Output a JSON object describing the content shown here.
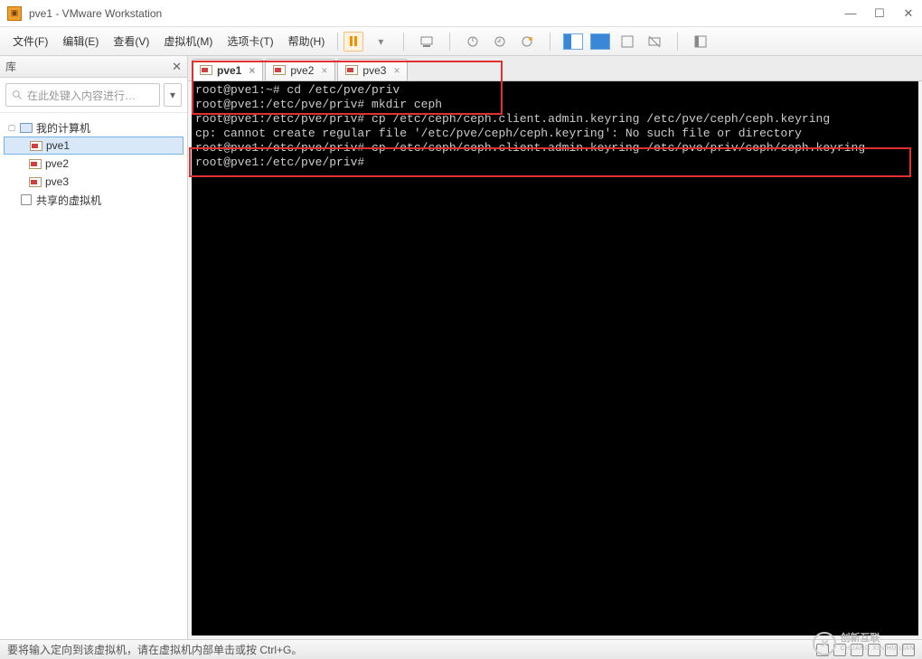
{
  "window": {
    "title": "pve1 - VMware Workstation"
  },
  "menu": {
    "file": "文件(F)",
    "edit": "编辑(E)",
    "view": "查看(V)",
    "vm": "虚拟机(M)",
    "tabs": "选项卡(T)",
    "help": "帮助(H)"
  },
  "sidebar": {
    "title": "库",
    "search_placeholder": "在此处键入内容进行…",
    "root": "我的计算机",
    "items": [
      "pve1",
      "pve2",
      "pve3"
    ],
    "shared": "共享的虚拟机"
  },
  "tabs": [
    {
      "label": "pve1",
      "active": true
    },
    {
      "label": "pve2",
      "active": false
    },
    {
      "label": "pve3",
      "active": false
    }
  ],
  "terminal_lines": [
    "root@pve1:~# cd /etc/pve/priv",
    "root@pve1:/etc/pve/priv# mkdir ceph",
    "root@pve1:/etc/pve/priv# cp /etc/ceph/ceph.client.admin.keyring /etc/pve/ceph/ceph.keyring",
    "cp: cannot create regular file '/etc/pve/ceph/ceph.keyring': No such file or directory",
    "root@pve1:/etc/pve/priv# cp /etc/ceph/ceph.client.admin.keyring /etc/pve/priv/ceph/ceph.keyring",
    "root@pve1:/etc/pve/priv# "
  ],
  "statusbar": {
    "text": "要将输入定向到该虚拟机，请在虚拟机内部单击或按 Ctrl+G。"
  },
  "watermark": {
    "brand": "创新互联",
    "sub": "CHUANG XIN HU LIAN"
  }
}
